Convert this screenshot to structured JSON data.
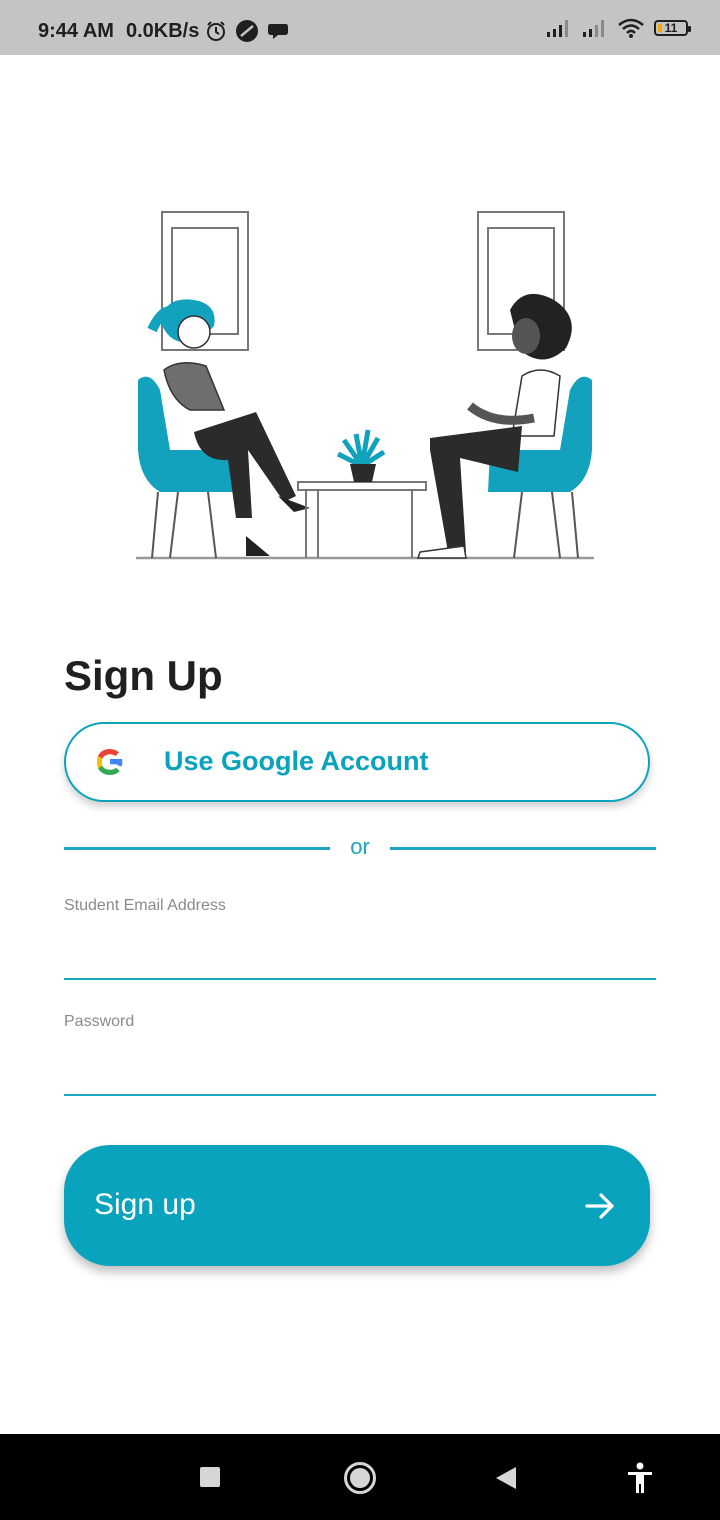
{
  "status_bar": {
    "time": "9:44 AM",
    "net_speed": "0.0KB/s",
    "battery": "11",
    "icons": [
      "alarm-icon",
      "vpn-icon",
      "chat-icon",
      "signal-icon",
      "signal-icon",
      "wifi-icon",
      "battery-icon"
    ]
  },
  "illustration": {
    "icon": "counseling-illustration"
  },
  "page": {
    "title": "Sign Up"
  },
  "google": {
    "label": "Use Google Account",
    "icon": "google-icon"
  },
  "divider": {
    "text": "or"
  },
  "form": {
    "email_label": "Student Email Address",
    "email_value": "",
    "password_label": "Password",
    "password_value": ""
  },
  "signup": {
    "label": "Sign up",
    "icon": "arrow-right-icon"
  },
  "nav": {
    "icons": [
      "recent-apps-icon",
      "home-icon",
      "back-icon",
      "accessibility-icon"
    ]
  },
  "colors": {
    "accent": "#0aa3bd",
    "status_bar": "#c4c4c4",
    "nav_bar": "#000000"
  }
}
